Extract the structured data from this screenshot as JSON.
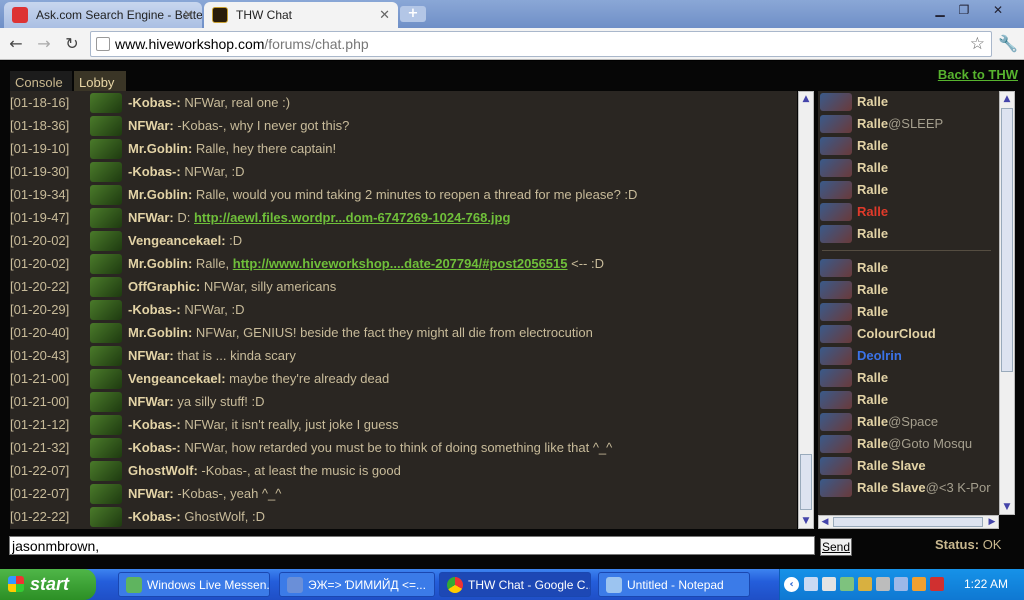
{
  "browser": {
    "tabs": [
      {
        "label": "Ask.com Search Engine - Bette",
        "icon": "ask-icon"
      },
      {
        "label": "THW Chat",
        "icon": "thw-icon"
      }
    ],
    "url_host": "www.hiveworkshop.com",
    "url_path": "/forums/chat.php"
  },
  "chat": {
    "tabs": [
      "Console",
      "Lobby"
    ],
    "back_link": "Back to THW",
    "messages": [
      {
        "time": "[01-18-16]",
        "nick": "-Kobas-:",
        "text": " NFWar, real one :)",
        "link": ""
      },
      {
        "time": "[01-18-36]",
        "nick": "NFWar:",
        "text": " -Kobas-, why I never got this?",
        "link": ""
      },
      {
        "time": "[01-19-10]",
        "nick": "Mr.Goblin:",
        "text": " Ralle, hey there captain!",
        "link": ""
      },
      {
        "time": "[01-19-30]",
        "nick": "-Kobas-:",
        "text": " NFWar, :D",
        "link": ""
      },
      {
        "time": "[01-19-34]",
        "nick": "Mr.Goblin:",
        "text": " Ralle, would you mind taking 2 minutes to reopen a thread for me please? :D",
        "link": ""
      },
      {
        "time": "[01-19-47]",
        "nick": "NFWar:",
        "text": " D: ",
        "link": "http://aewl.files.wordpr...dom-6747269-1024-768.jpg"
      },
      {
        "time": "[01-20-02]",
        "nick": "Vengeancekael:",
        "text": " :D",
        "link": ""
      },
      {
        "time": "[01-20-02]",
        "nick": "Mr.Goblin:",
        "text": " Ralle, ",
        "link": "http://www.hiveworkshop....date-207794/#post2056515",
        "after": " <-- :D"
      },
      {
        "time": "[01-20-22]",
        "nick": "OffGraphic:",
        "text": " NFWar, silly americans",
        "link": ""
      },
      {
        "time": "[01-20-29]",
        "nick": "-Kobas-:",
        "text": " NFWar, :D",
        "link": ""
      },
      {
        "time": "[01-20-40]",
        "nick": "Mr.Goblin:",
        "text": " NFWar, GENIUS! beside the fact they might all die from electrocution",
        "link": ""
      },
      {
        "time": "[01-20-43]",
        "nick": "NFWar:",
        "text": " that is ... kinda scary",
        "link": ""
      },
      {
        "time": "[01-21-00]",
        "nick": "Vengeancekael:",
        "text": " maybe they're already dead",
        "link": ""
      },
      {
        "time": "[01-21-00]",
        "nick": "NFWar:",
        "text": " ya silly stuff! :D",
        "link": ""
      },
      {
        "time": "[01-21-12]",
        "nick": "-Kobas-:",
        "text": " NFWar, it isn't really, just joke I guess",
        "link": ""
      },
      {
        "time": "[01-21-32]",
        "nick": "-Kobas-:",
        "text": " NFWar, how retarded you must be to think of doing something like that ^_^",
        "link": ""
      },
      {
        "time": "[01-22-07]",
        "nick": "GhostWolf:",
        "text": " -Kobas-, at least the music is good",
        "link": ""
      },
      {
        "time": "[01-22-07]",
        "nick": "NFWar:",
        "text": " -Kobas-, yeah ^_^",
        "link": ""
      },
      {
        "time": "[01-22-22]",
        "nick": "-Kobas-:",
        "text": " GhostWolf, :D",
        "link": ""
      }
    ],
    "users_top": [
      {
        "name": "Ralle",
        "status": "",
        "color": "#e3d3a6"
      },
      {
        "name": "Ralle",
        "status": "@SLEEP",
        "color": "#e3d3a6"
      },
      {
        "name": "Ralle",
        "status": "",
        "color": "#e3d3a6"
      },
      {
        "name": "Ralle",
        "status": "",
        "color": "#e3d3a6"
      },
      {
        "name": "Ralle",
        "status": "",
        "color": "#e3d3a6"
      },
      {
        "name": "Ralle",
        "status": "",
        "color": "#e03a2a"
      },
      {
        "name": "Ralle",
        "status": "",
        "color": "#e3d3a6"
      }
    ],
    "users_bottom": [
      {
        "name": "Ralle",
        "status": "",
        "color": "#e3d3a6"
      },
      {
        "name": "Ralle",
        "status": "",
        "color": "#e3d3a6"
      },
      {
        "name": "Ralle",
        "status": "",
        "color": "#e3d3a6"
      },
      {
        "name": "ColourCloud",
        "status": "",
        "color": "#e3d3a6"
      },
      {
        "name": "Deolrin",
        "status": "",
        "color": "#3b73e8"
      },
      {
        "name": "Ralle",
        "status": "",
        "color": "#e3d3a6"
      },
      {
        "name": "Ralle",
        "status": "",
        "color": "#e3d3a6"
      },
      {
        "name": "Ralle",
        "status": "@Space",
        "color": "#e3d3a6"
      },
      {
        "name": "Ralle",
        "status": "@Goto Mosqu",
        "color": "#e3d3a6"
      },
      {
        "name": "Ralle Slave",
        "status": "",
        "color": "#e3d3a6"
      },
      {
        "name": "Ralle Slave",
        "status": "@<3 K-Por",
        "color": "#e3d3a6"
      }
    ],
    "input_value": "jasonmbrown,",
    "send_label": "Send",
    "status_label": "Status:",
    "status_value": "OK"
  },
  "taskbar": {
    "start_label": "start",
    "tasks": [
      {
        "label": "Windows Live Messen...",
        "active": false
      },
      {
        "label": "ЭЖ=> ƊИМИЙД <=...",
        "active": false
      },
      {
        "label": "THW Chat - Google C...",
        "active": true
      },
      {
        "label": "Untitled - Notepad",
        "active": false
      }
    ],
    "clock": "1:22 AM"
  },
  "colors": {
    "link": "#6fbf3a",
    "nick": "#e3d3a6",
    "panel_bg": "#2a2622",
    "text": "#c8bb9a"
  }
}
